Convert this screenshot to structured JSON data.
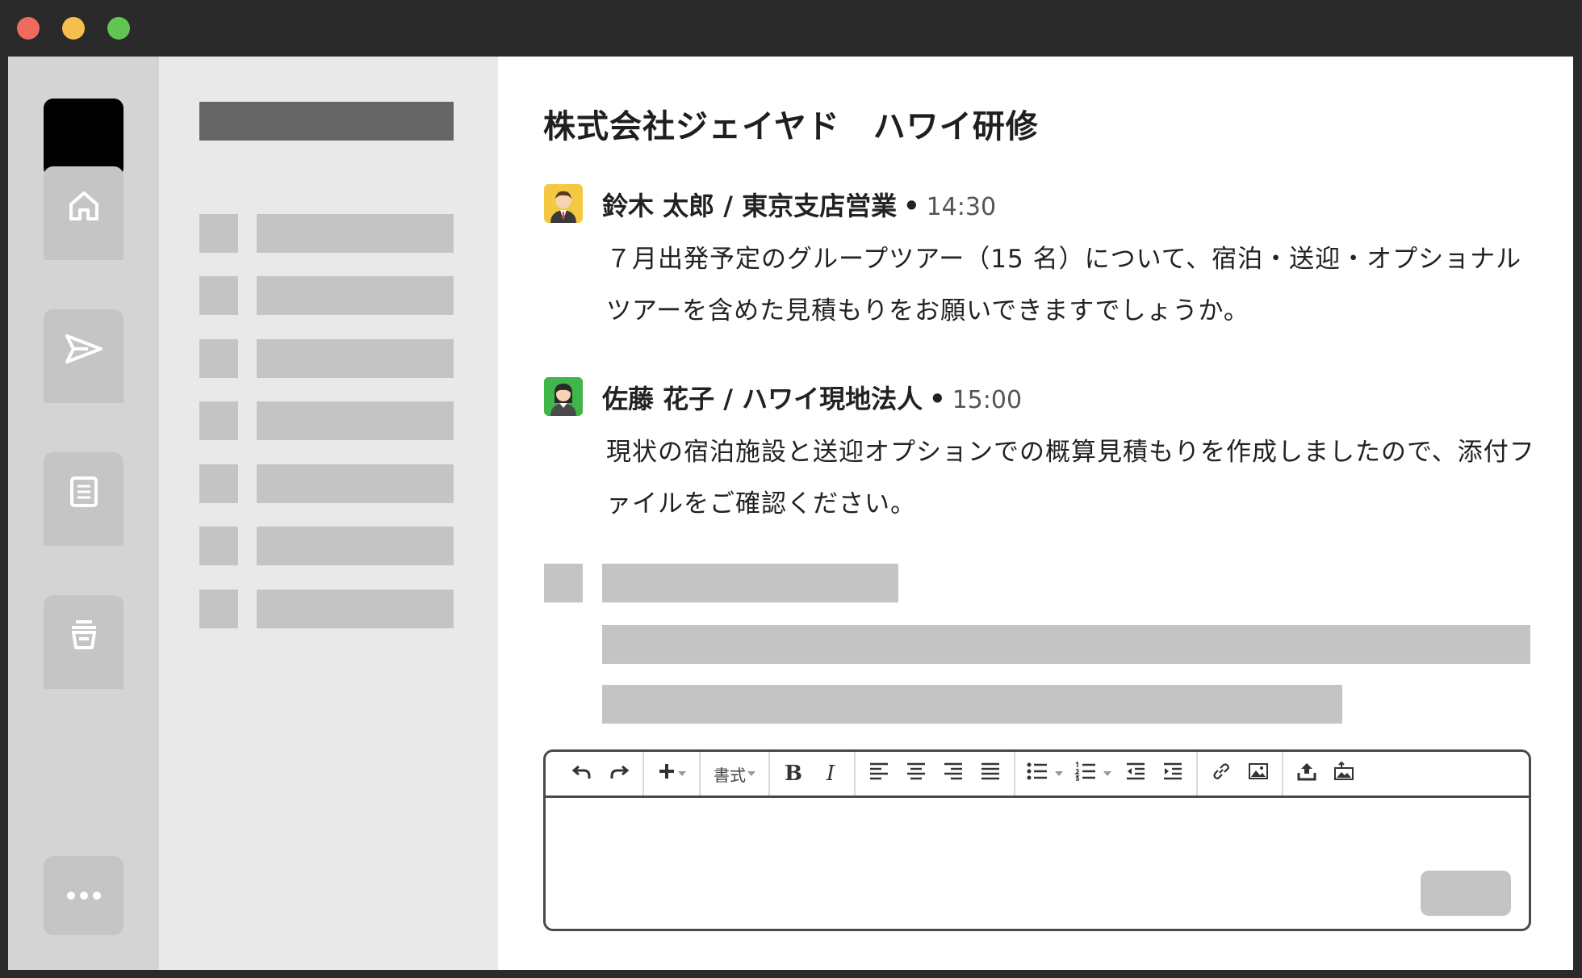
{
  "window": {
    "traffic_lights": [
      "close",
      "minimize",
      "maximize"
    ]
  },
  "rail": {
    "items": [
      {
        "name": "home",
        "icon": "home-icon"
      },
      {
        "name": "send",
        "icon": "send-icon"
      },
      {
        "name": "document",
        "icon": "document-icon"
      },
      {
        "name": "archive",
        "icon": "archive-icon"
      }
    ],
    "more_icon": "more-icon"
  },
  "room": {
    "title": "株式会社ジェイヤド　ハワイ研修"
  },
  "messages": [
    {
      "author": "鈴木 太郎 / 東京支店営業",
      "separator": "•",
      "time": "14:30",
      "avatar": "male-avatar-icon",
      "avatar_color": "#f5c842",
      "body": "７月出発予定のグループツアー（15 名）について、宿泊・送迎・オプショナルツアーを含めた見積もりをお願いできますでしょうか。"
    },
    {
      "author": "佐藤 花子 / ハワイ現地法人",
      "separator": "•",
      "time": "15:00",
      "avatar": "female-avatar-icon",
      "avatar_color": "#3fb54a",
      "body": "現状の宿泊施設と送迎オプションでの概算見積もりを作成しましたので、添付ファイルをご確認ください。"
    }
  ],
  "editor": {
    "toolbar": {
      "format_label": "書式",
      "bold_label": "B",
      "italic_label": "I"
    }
  },
  "colors": {
    "rail_bg": "#d4d4d4",
    "channels_bg": "#e9e9e9",
    "placeholder": "#c4c4c4",
    "title_bar": "#2a2a2a"
  }
}
